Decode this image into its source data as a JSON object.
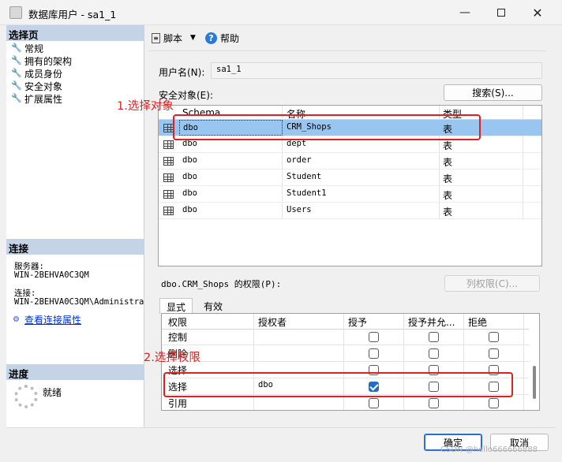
{
  "window": {
    "title": "数据库用户 - sa1_1",
    "minimize_icon": "minimize-icon",
    "maximize_icon": "maximize-icon",
    "close_icon": "close-icon"
  },
  "sidebar": {
    "select_page_header": "选择页",
    "pages": [
      "常规",
      "拥有的架构",
      "成员身份",
      "安全对象",
      "扩展属性"
    ],
    "connection_header": "连接",
    "server_label": "服务器:",
    "server_value": "WIN-2BEHVA0C3QM",
    "connection_label": "连接:",
    "connection_value": "WIN-2BEHVA0C3QM\\Administrat",
    "view_connection_properties": "查看连接属性",
    "progress_header": "进度",
    "progress_status": "就绪"
  },
  "toolbar": {
    "script_label": "脚本",
    "help_label": "帮助"
  },
  "user_name": {
    "label": "用户名(N):",
    "value": "sa1_1"
  },
  "securables": {
    "label": "安全对象(E):",
    "search_button": "搜索(S)...",
    "columns": [
      "Schema",
      "名称",
      "类型"
    ],
    "rows": [
      {
        "schema": "dbo",
        "name": "CRM_Shops",
        "type": "表",
        "selected": true
      },
      {
        "schema": "dbo",
        "name": "dept",
        "type": "表",
        "selected": false
      },
      {
        "schema": "dbo",
        "name": "order",
        "type": "表",
        "selected": false
      },
      {
        "schema": "dbo",
        "name": "Student",
        "type": "表",
        "selected": false
      },
      {
        "schema": "dbo",
        "name": "Student1",
        "type": "表",
        "selected": false
      },
      {
        "schema": "dbo",
        "name": "Users",
        "type": "表",
        "selected": false
      }
    ]
  },
  "permissions": {
    "label": "dbo.CRM_Shops 的权限(P):",
    "column_permissions_button": "列权限(C)...",
    "tabs": [
      "显式",
      "有效"
    ],
    "columns": [
      "权限",
      "授权者",
      "授予",
      "授予并允...",
      "拒绝"
    ],
    "rows": [
      {
        "permission": "控制",
        "grantor": "",
        "grant": false,
        "with_grant": false,
        "deny": false
      },
      {
        "permission": "删除",
        "grantor": "",
        "grant": false,
        "with_grant": false,
        "deny": false
      },
      {
        "permission": "选择",
        "grantor": "",
        "grant": false,
        "with_grant": false,
        "deny": false
      },
      {
        "permission": "选择",
        "grantor": "dbo",
        "grant": true,
        "with_grant": false,
        "deny": false
      },
      {
        "permission": "引用",
        "grantor": "",
        "grant": false,
        "with_grant": false,
        "deny": false
      }
    ]
  },
  "annotations": {
    "step1": "1.选择对象",
    "step2": "2.选择权限",
    "color": "#e02020"
  },
  "buttons": {
    "ok": "确定",
    "cancel": "取消"
  },
  "watermark": "CSDN @hello666666888"
}
